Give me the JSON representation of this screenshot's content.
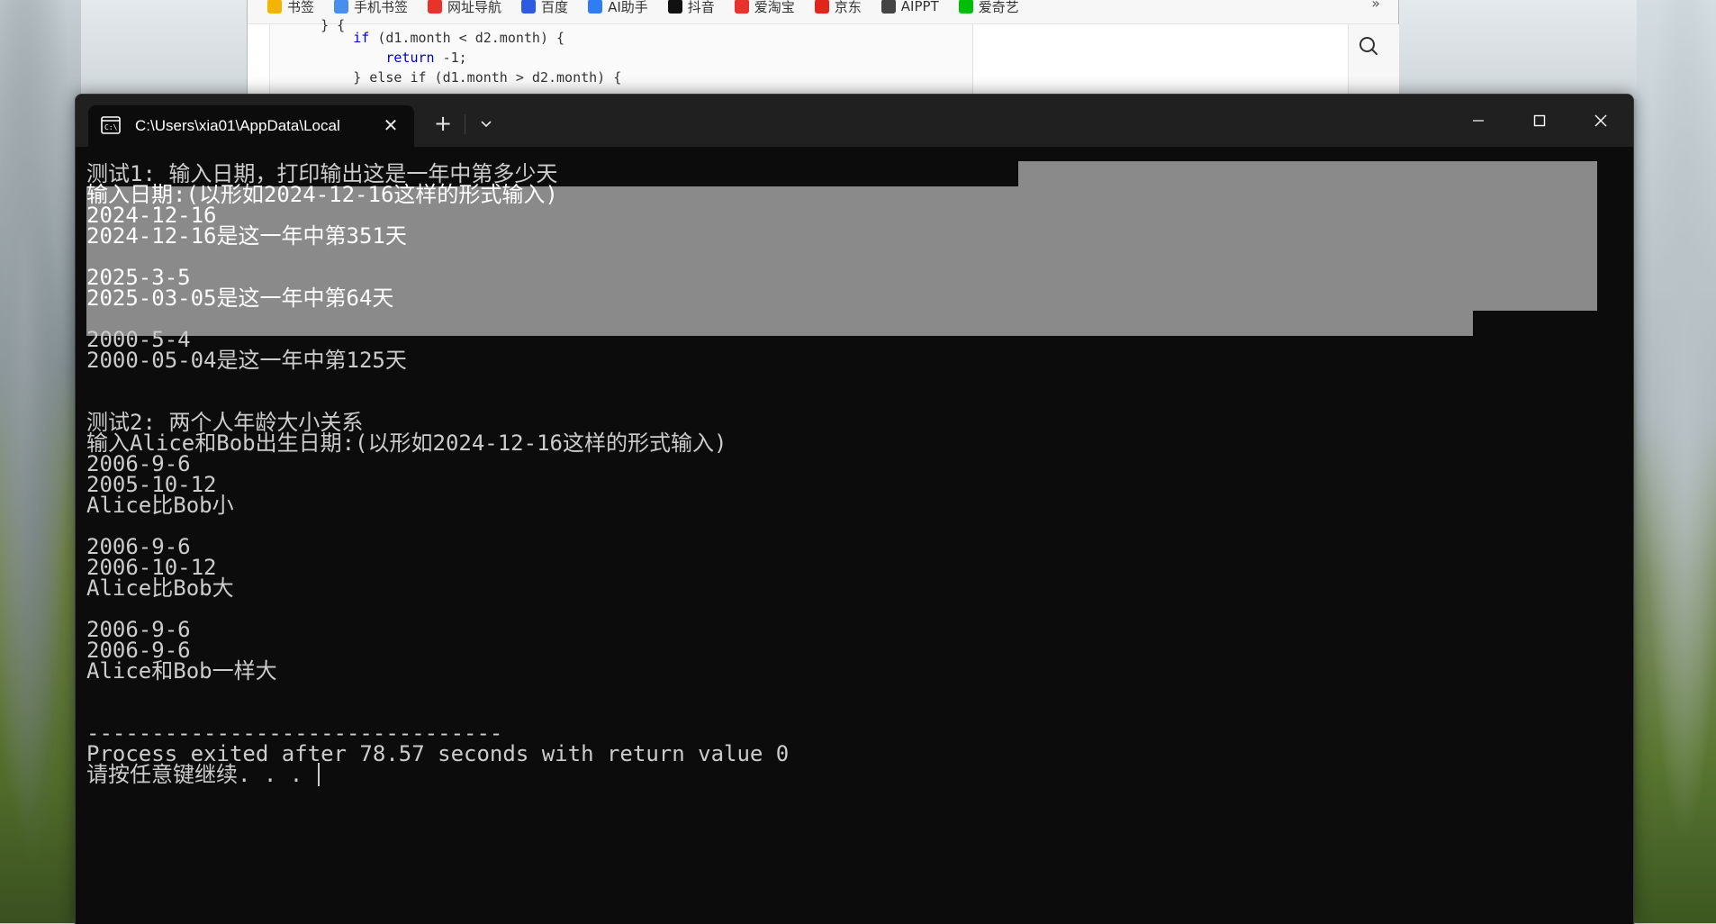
{
  "browser": {
    "bookmarks": [
      {
        "label": "书签",
        "icon": "star-icon",
        "color": "#f5b400"
      },
      {
        "label": "手机书签",
        "icon": "phone-icon",
        "color": "#4a8df0"
      },
      {
        "label": "网址导航",
        "icon": "nav-icon",
        "color": "#e8322b"
      },
      {
        "label": "百度",
        "icon": "baidu-icon",
        "color": "#2d5be3"
      },
      {
        "label": "AI助手",
        "icon": "ai-assistant-icon",
        "color": "#2f7cf6"
      },
      {
        "label": "抖音",
        "icon": "douyin-icon",
        "color": "#111111"
      },
      {
        "label": "爱淘宝",
        "icon": "taobao-icon",
        "color": "#e8322b"
      },
      {
        "label": "京东",
        "icon": "jd-icon",
        "color": "#e1251b"
      },
      {
        "label": "AIPPT",
        "icon": "aippt-icon",
        "color": "#444444"
      },
      {
        "label": "爱奇艺",
        "icon": "iqiyi-icon",
        "color": "#00be06"
      }
    ],
    "more": "»",
    "code": [
      "    } {",
      "        if (d1.month < d2.month) {",
      "            return -1;",
      "        } else if (d1.month > d2.month) {"
    ]
  },
  "terminal": {
    "tab_title": "C:\\Users\\xia01\\AppData\\Local",
    "tab_close": "✕",
    "new_tab": "+",
    "lines": [
      "测试1: 输入日期，打印输出这是一年中第多少天",
      "输入日期:(以形如2024-12-16这样的形式输入)",
      "2024-12-16",
      "2024-12-16是这一年中第351天",
      "",
      "2025-3-5",
      "2025-03-05是这一年中第64天",
      "",
      "2000-5-4",
      "2000-05-04是这一年中第125天",
      "",
      "",
      "测试2: 两个人年龄大小关系",
      "输入Alice和Bob出生日期:(以形如2024-12-16这样的形式输入)",
      "2006-9-6",
      "2005-10-12",
      "Alice比Bob小",
      "",
      "2006-9-6",
      "2006-10-12",
      "Alice比Bob大",
      "",
      "2006-9-6",
      "2006-9-6",
      "Alice和Bob一样大",
      "",
      "",
      "--------------------------------",
      "Process exited after 78.57 seconds with return value 0",
      "请按任意键继续. . . "
    ]
  },
  "colors": {
    "terminal_bg": "#0c0c0c",
    "terminal_fg": "#cccccc",
    "titlebar": "#202020",
    "selection": "#8a8a8a",
    "keyword": "#0000cc"
  }
}
